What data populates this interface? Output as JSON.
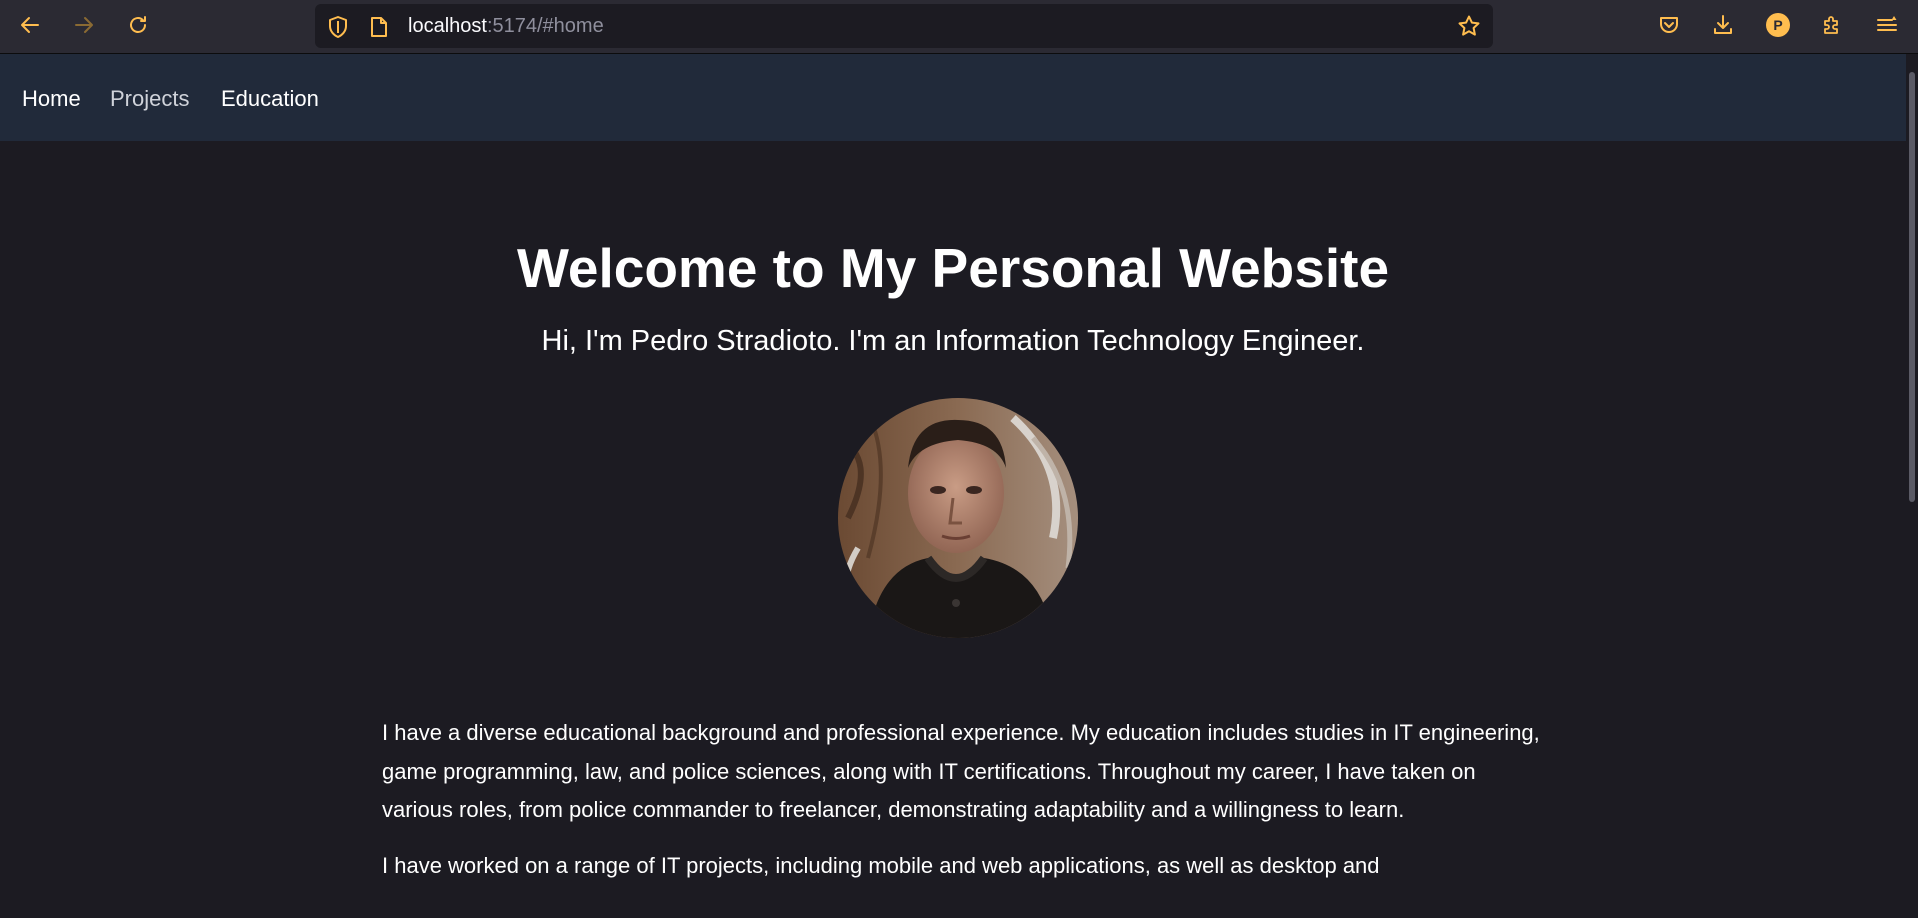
{
  "browser": {
    "url_host": "localhost",
    "url_path": ":5174/#home",
    "profile_initial": "P",
    "colors": {
      "accent": "#ffbd4f",
      "toolbar": "#2b2a33"
    }
  },
  "nav": {
    "links": [
      {
        "label": "Home"
      },
      {
        "label": "Projects"
      },
      {
        "label": "Education"
      }
    ]
  },
  "hero": {
    "title": "Welcome to My Personal Website",
    "subtitle": "Hi, I'm Pedro Stradioto. I'm an Information Technology Engineer."
  },
  "about": {
    "paragraphs": [
      "I have a diverse educational background and professional experience. My education includes studies in IT engineering, game programming, law, and police sciences, along with IT certifications. Throughout my career, I have taken on various roles, from police commander to freelancer, demonstrating adaptability and a willingness to learn.",
      "I have worked on a range of IT projects, including mobile and web applications, as well as desktop and"
    ]
  },
  "colors": {
    "page_background": "#1c1b22",
    "nav_background": "#212a3a",
    "text": "#ffffff"
  }
}
